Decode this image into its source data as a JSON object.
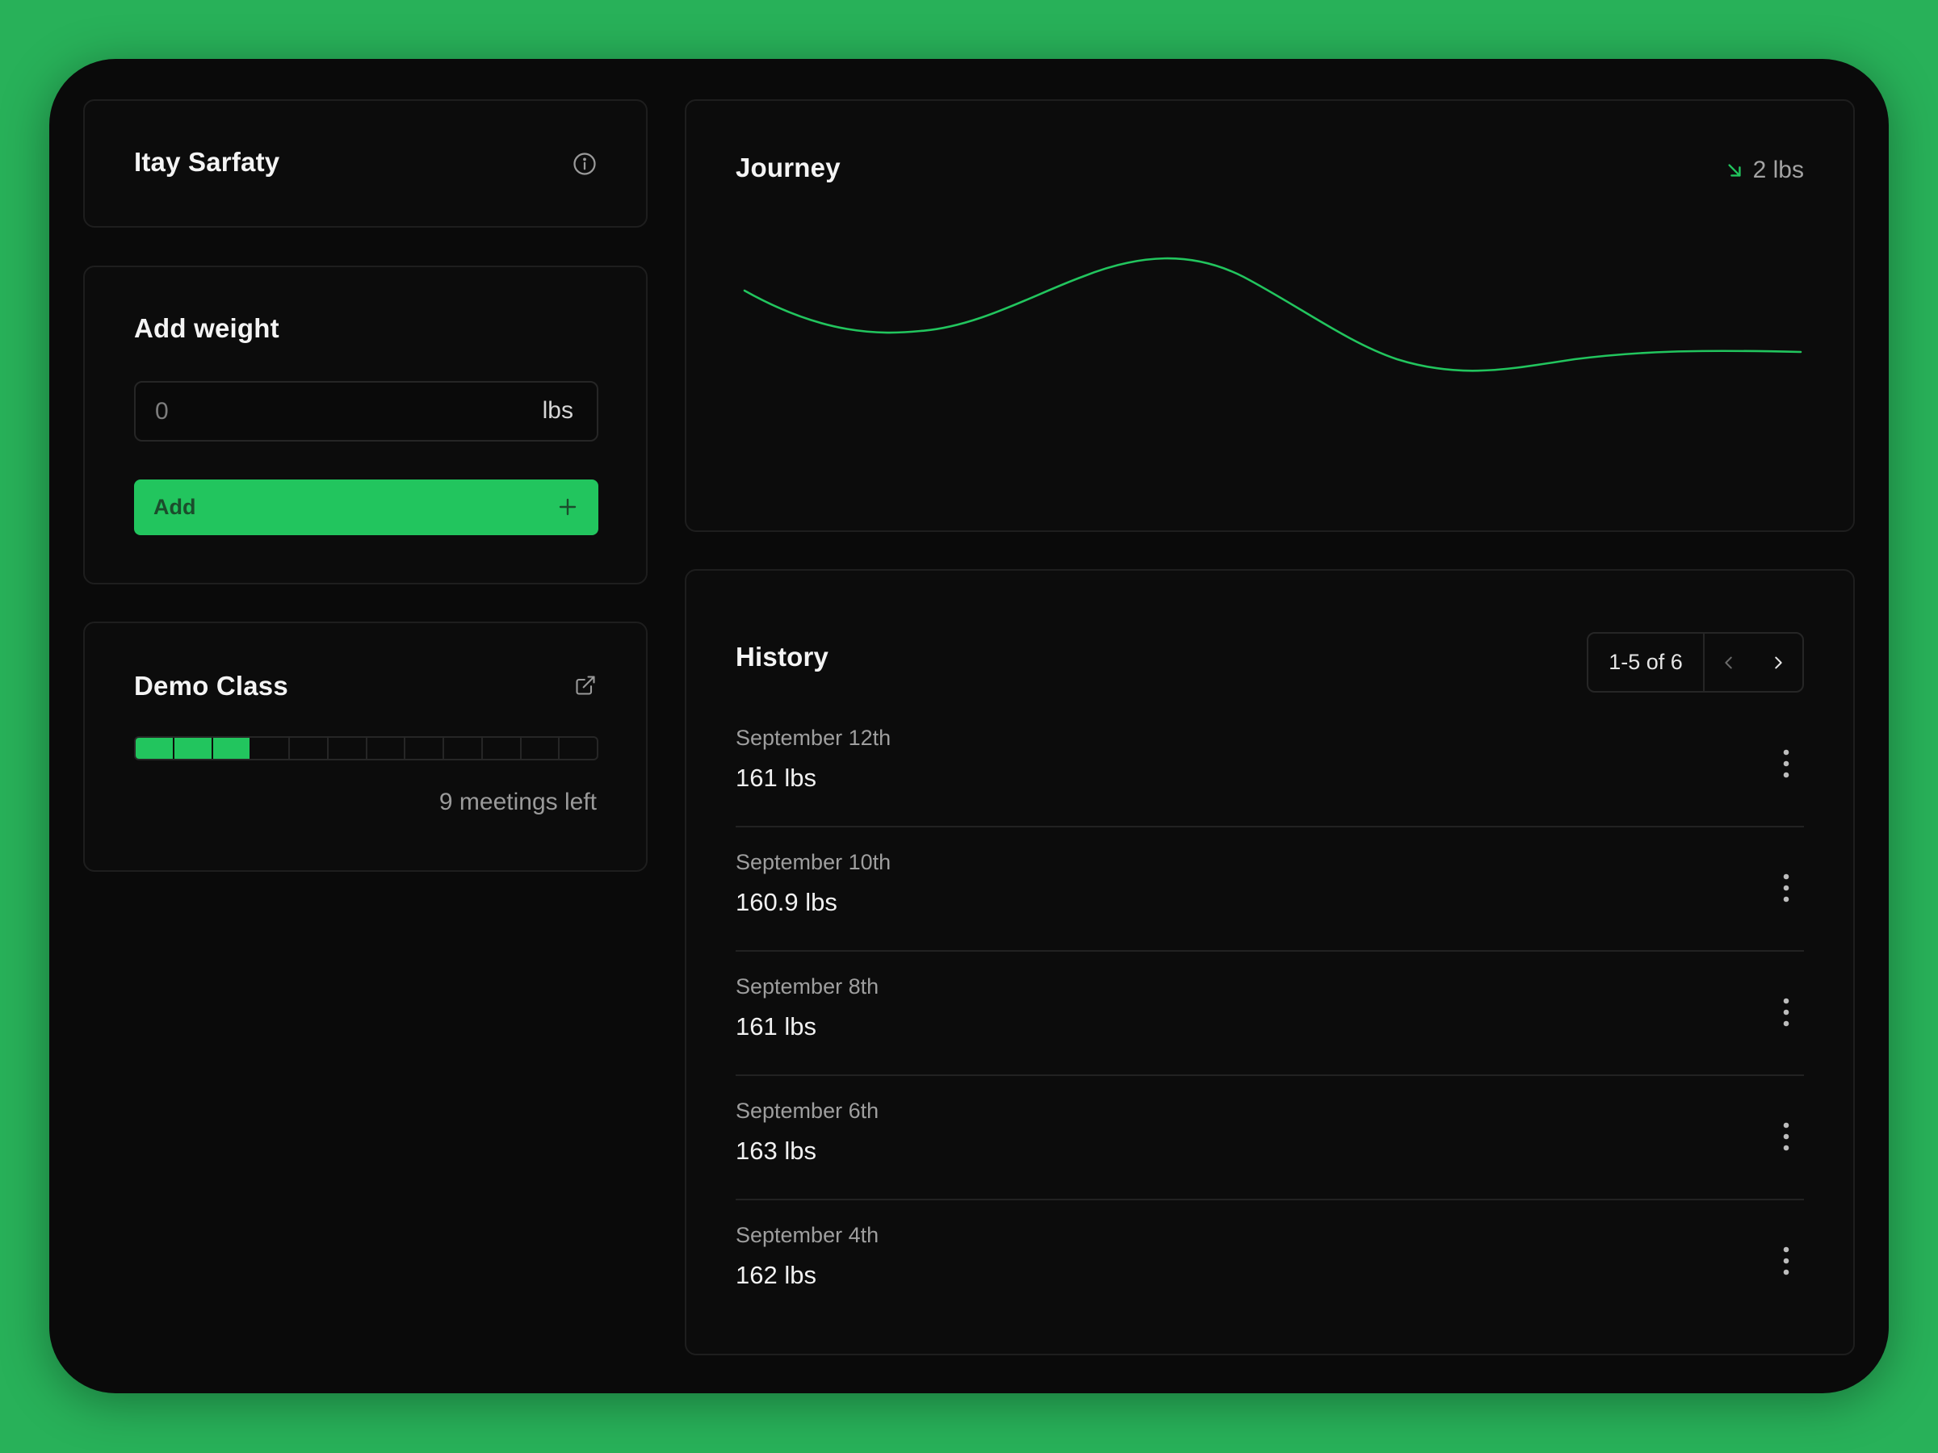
{
  "profile": {
    "name": "Itay Sarfaty",
    "icon": "info-icon"
  },
  "add_weight": {
    "title": "Add weight",
    "input_value": "",
    "input_placeholder": "0",
    "unit": "lbs",
    "button_label": "Add",
    "button_icon": "plus-icon",
    "accent_color": "#22c55e"
  },
  "class": {
    "title": "Demo Class",
    "icon": "external-link-icon",
    "meetings_completed": 3,
    "meetings_total": 12,
    "meetings_left_text": "9 meetings left"
  },
  "journey": {
    "title": "Journey",
    "trend_icon": "arrow-down-right-icon",
    "trend_value": "2 lbs",
    "trend_color": "#22c55e"
  },
  "history": {
    "title": "History",
    "pager_range": "1-5 of 6",
    "prev_icon": "chevron-left-icon",
    "next_icon": "chevron-right-icon",
    "row_menu_icon": "more-vertical-icon",
    "entries": [
      {
        "date": "September 12th",
        "weight": "161 lbs"
      },
      {
        "date": "September 10th",
        "weight": "160.9 lbs"
      },
      {
        "date": "September 8th",
        "weight": "161 lbs"
      },
      {
        "date": "September 6th",
        "weight": "163 lbs"
      },
      {
        "date": "September 4th",
        "weight": "162 lbs"
      }
    ]
  },
  "colors": {
    "background": "#28b159",
    "window": "#0a0a0a",
    "card_border": "#1e1e1e",
    "accent": "#22c55e"
  }
}
